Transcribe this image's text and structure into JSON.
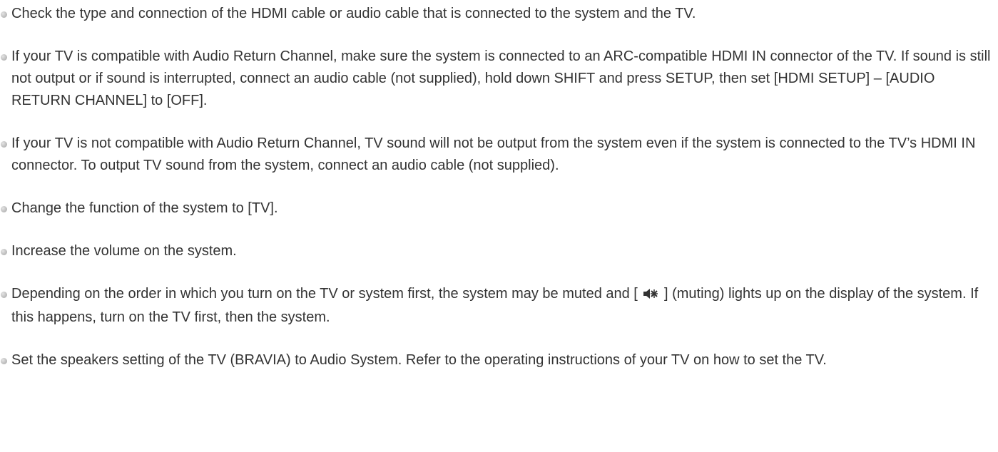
{
  "items": [
    {
      "text": "Check the type and connection of the HDMI cable or audio cable that is connected to the system and the TV."
    },
    {
      "text": "If your TV is compatible with Audio Return Channel, make sure the system is connected to an ARC-compatible HDMI IN connector of the TV. If sound is still not output or if sound is interrupted, connect an audio cable (not supplied), hold down SHIFT and press SETUP, then set [HDMI SETUP] – [AUDIO RETURN CHANNEL] to [OFF]."
    },
    {
      "text": "If your TV is not compatible with Audio Return Channel, TV sound will not be output from the system even if the system is connected to the TV’s HDMI IN connector. To output TV sound from the system, connect an audio cable (not supplied)."
    },
    {
      "text": "Change the function of the system to [TV]."
    },
    {
      "text": "Increase the volume on the system."
    },
    {
      "text_before": "Depending on the order in which you turn on the TV or system first, the system may be muted and [",
      "icon": "muting-icon",
      "text_after": "] (muting) lights up on the display of the system. If this happens, turn on the TV first, then the system."
    },
    {
      "text": "Set the speakers setting of the TV (BRAVIA) to Audio System. Refer to the operating instructions of your TV on how to set the TV."
    }
  ]
}
